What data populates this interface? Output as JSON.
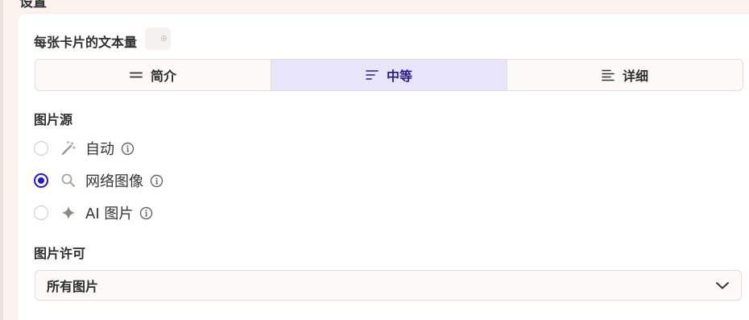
{
  "settings": {
    "heading": "设置"
  },
  "text_amount": {
    "label": "每张卡片的文本量",
    "options": [
      {
        "label": "简介",
        "icon": "lines-short-icon",
        "selected": false
      },
      {
        "label": "中等",
        "icon": "lines-medium-icon",
        "selected": true
      },
      {
        "label": "详细",
        "icon": "lines-detailed-icon",
        "selected": false
      }
    ]
  },
  "image_source": {
    "label": "图片源",
    "options": [
      {
        "label": "自动",
        "icon": "magic-wand-icon",
        "selected": false
      },
      {
        "label": "网络图像",
        "icon": "search-icon",
        "selected": true
      },
      {
        "label": "AI 图片",
        "icon": "sparkle-icon",
        "selected": false
      }
    ]
  },
  "image_license": {
    "label": "图片许可",
    "selected_value": "所有图片"
  },
  "colors": {
    "accent": "#2a16d8",
    "active_segment_bg": "#e8e5fb",
    "page_bg": "#fdf3ee"
  }
}
